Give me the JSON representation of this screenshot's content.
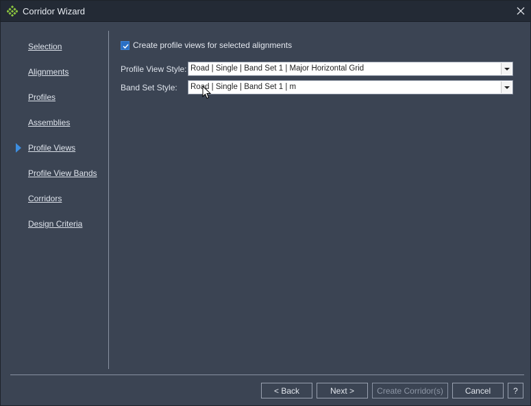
{
  "window": {
    "title": "Corridor Wizard",
    "close_icon": "close-icon",
    "app_icon": "corridor-wizard-icon"
  },
  "nav": {
    "items": [
      {
        "label": "Selection"
      },
      {
        "label": "Alignments"
      },
      {
        "label": "Profiles"
      },
      {
        "label": "Assemblies"
      },
      {
        "label": "Profile Views",
        "current": true
      },
      {
        "label": "Profile View Bands"
      },
      {
        "label": "Corridors"
      },
      {
        "label": "Design Criteria"
      }
    ],
    "current_marker_icon": "current-step-arrow-icon"
  },
  "main": {
    "create_profile_views": {
      "label": "Create profile views for selected alignments",
      "checked": true
    },
    "profile_view_style": {
      "label": "Profile View Style:",
      "value": "Road | Single | Band Set 1 | Major Horizontal Grid"
    },
    "band_set_style": {
      "label": "Band Set Style:",
      "value": "Road | Single | Band Set 1 | m"
    }
  },
  "footer": {
    "back_label": "< Back",
    "next_label": "Next >",
    "create_label": "Create Corridor(s)",
    "cancel_label": "Cancel",
    "help_label": "?"
  },
  "colors": {
    "accent": "#3d8ee0",
    "background": "#3b4453",
    "titlebar": "#232a35"
  }
}
